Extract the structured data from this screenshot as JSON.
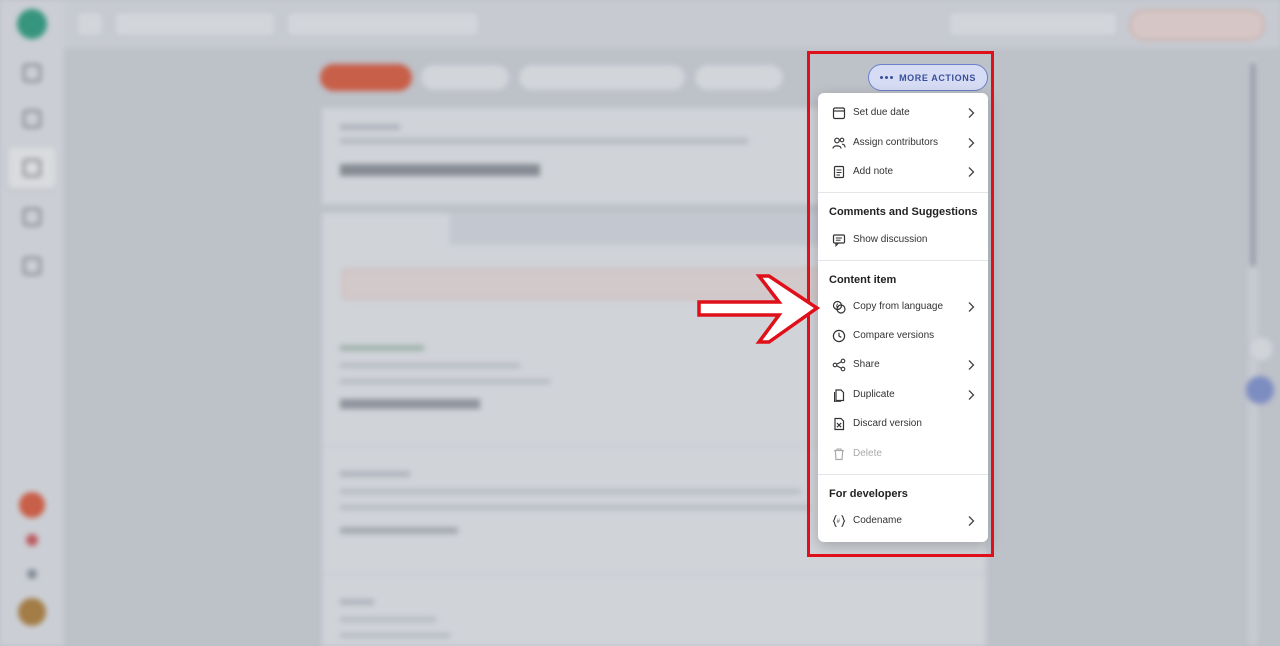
{
  "more_actions": {
    "label": "MORE ACTIONS"
  },
  "menu": {
    "items_top": [
      {
        "label": "Set due date",
        "icon": "calendar-icon",
        "submenu": true
      },
      {
        "label": "Assign contributors",
        "icon": "users-icon",
        "submenu": true
      },
      {
        "label": "Add note",
        "icon": "note-icon",
        "submenu": true
      }
    ],
    "comments_section": {
      "title": "Comments and Suggestions",
      "items": [
        {
          "label": "Show discussion",
          "icon": "discussion-icon",
          "submenu": false
        }
      ]
    },
    "content_section": {
      "title": "Content item",
      "items": [
        {
          "label": "Copy from language",
          "icon": "language-icon",
          "submenu": true
        },
        {
          "label": "Compare versions",
          "icon": "clock-icon",
          "submenu": false
        },
        {
          "label": "Share",
          "icon": "share-icon",
          "submenu": true
        },
        {
          "label": "Duplicate",
          "icon": "duplicate-icon",
          "submenu": true
        },
        {
          "label": "Discard version",
          "icon": "discard-icon",
          "submenu": false
        },
        {
          "label": "Delete",
          "icon": "trash-icon",
          "submenu": false,
          "disabled": true
        }
      ]
    },
    "dev_section": {
      "title": "For developers",
      "items": [
        {
          "label": "Codename",
          "icon": "codename-icon",
          "submenu": true
        }
      ]
    }
  },
  "highlight_color": "#ffff15",
  "annotation_color": "#e0101a",
  "accent_color": "#e8542f",
  "brand_color": "#1e9e7a"
}
